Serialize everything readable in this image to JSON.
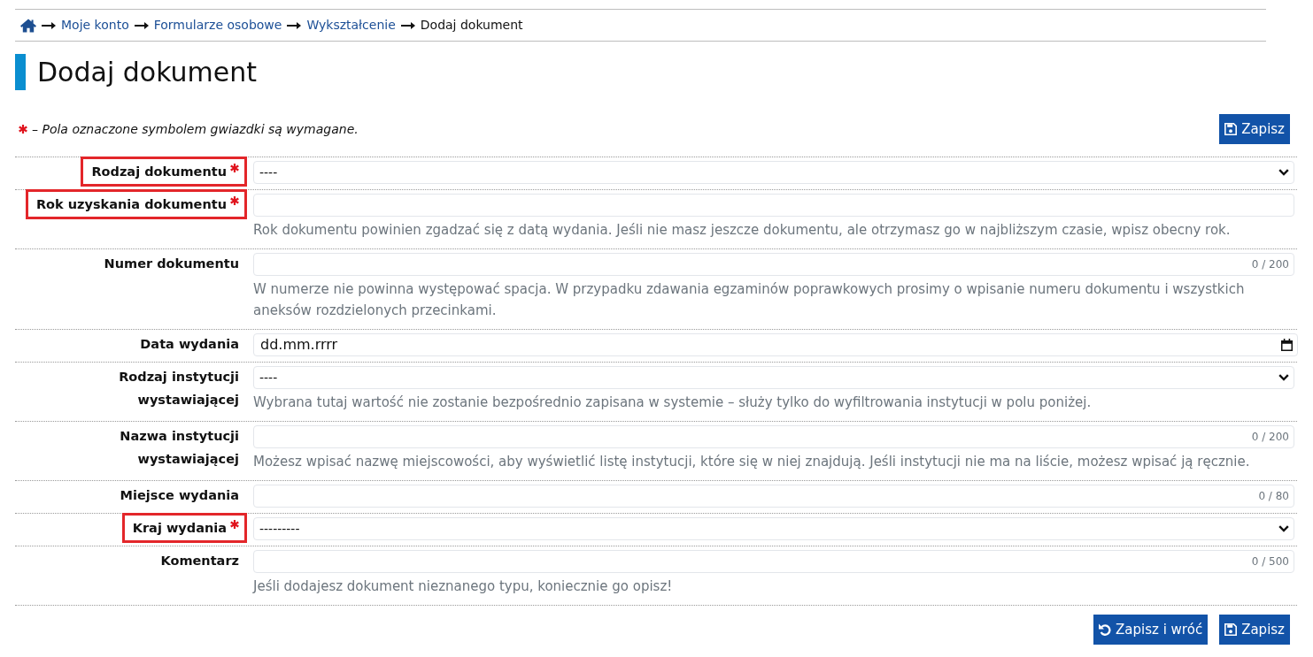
{
  "breadcrumb": {
    "items": [
      {
        "label": "Moje konto",
        "current": false
      },
      {
        "label": "Formularze osobowe",
        "current": false
      },
      {
        "label": "Wykształcenie",
        "current": false
      },
      {
        "label": "Dodaj dokument",
        "current": true
      }
    ]
  },
  "page_title": "Dodaj dokument",
  "required_note": "– Pola oznaczone symbolem gwiazdki są wymagane.",
  "top_buttons": [
    {
      "label": "Zapisz",
      "kind": "save"
    }
  ],
  "fields": [
    {
      "label": "Rodzaj dokumentu",
      "required": true,
      "highlighted": true,
      "kind": "select",
      "value": "----"
    },
    {
      "label": "Rok uzyskania dokumentu",
      "required": true,
      "highlighted": true,
      "kind": "text",
      "hint": "Rok dokumentu powinien zgadzać się z datą wydania. Jeśli nie masz jeszcze dokumentu, ale otrzymasz go w najbliższym czasie, wpisz obecny rok."
    },
    {
      "label": "Numer dokumentu",
      "required": false,
      "highlighted": false,
      "kind": "text",
      "counter": "0 / 200",
      "hint": "W numerze nie powinna występować spacja. W przypadku zdawania egzaminów poprawkowych prosimy o wpisanie numeru dokumentu i wszystkich aneksów rozdzielonych przecinkami."
    },
    {
      "label": "Data wydania",
      "required": false,
      "highlighted": false,
      "kind": "date",
      "value": "dd.mm.rrrr"
    },
    {
      "label": "Rodzaj instytucji wystawiającej",
      "required": false,
      "highlighted": false,
      "kind": "select",
      "value": "----",
      "hint": "Wybrana tutaj wartość nie zostanie bezpośrednio zapisana w systemie – służy tylko do wyfiltrowania instytucji w polu poniżej."
    },
    {
      "label": "Nazwa instytucji wystawiającej",
      "required": false,
      "highlighted": false,
      "kind": "text",
      "counter": "0 / 200",
      "hint": "Możesz wpisać nazwę miejscowości, aby wyświetlić listę instytucji, które się w niej znajdują. Jeśli instytucji nie ma na liście, możesz wpisać ją ręcznie."
    },
    {
      "label": "Miejsce wydania",
      "required": false,
      "highlighted": false,
      "kind": "text",
      "counter": "0 / 80"
    },
    {
      "label": "Kraj wydania",
      "required": true,
      "highlighted": true,
      "kind": "select",
      "value": "---------"
    },
    {
      "label": "Komentarz",
      "required": false,
      "highlighted": false,
      "kind": "text",
      "counter": "0 / 500",
      "hint": "Jeśli dodajesz dokument nieznanego typu, koniecznie go opisz!"
    }
  ],
  "bottom_buttons": [
    {
      "label": "Zapisz i wróć",
      "kind": "save_return"
    },
    {
      "label": "Zapisz",
      "kind": "save"
    }
  ]
}
